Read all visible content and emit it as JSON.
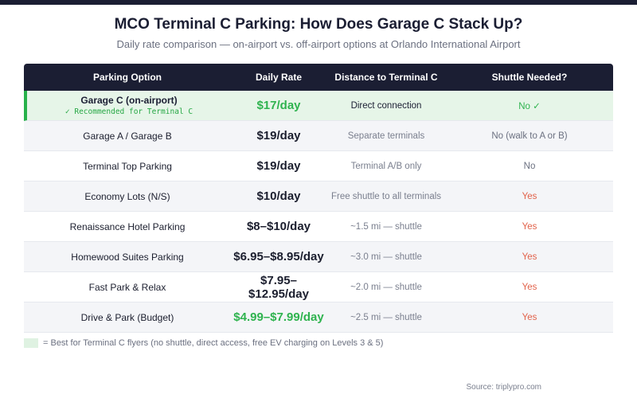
{
  "title": "MCO Terminal C Parking: How Does Garage C Stack Up?",
  "subtitle": "Daily rate comparison — on-airport vs. off-airport options at Orlando International Airport",
  "headers": [
    "Parking Option",
    "Daily Rate",
    "Distance to Terminal C",
    "Shuttle Needed?"
  ],
  "rows": [
    {
      "option": "Garage C (on-airport)",
      "note": "✓ Recommended for Terminal C",
      "rate": "$17/day",
      "distance": "Direct connection",
      "shuttle": "No ✓"
    },
    {
      "option": "Garage A / Garage B",
      "rate": "$19/day",
      "distance": "Separate terminals",
      "shuttle": "No (walk to A or B)"
    },
    {
      "option": "Terminal Top Parking",
      "rate": "$19/day",
      "distance": "Terminal A/B only",
      "shuttle": "No"
    },
    {
      "option": "Economy Lots (N/S)",
      "rate": "$10/day",
      "distance": "Free shuttle to all terminals",
      "shuttle": "Yes"
    },
    {
      "option": "Renaissance Hotel Parking",
      "rate": "$8–$10/day",
      "distance": "~1.5 mi — shuttle",
      "shuttle": "Yes"
    },
    {
      "option": "Homewood Suites Parking",
      "rate": "$6.95–$8.95/day",
      "distance": "~3.0 mi — shuttle",
      "shuttle": "Yes"
    },
    {
      "option": "Fast Park & Relax",
      "rate": "$7.95–$12.95/day",
      "distance": "~2.0 mi — shuttle",
      "shuttle": "Yes"
    },
    {
      "option": "Drive & Park (Budget)",
      "rate": "$4.99–$7.99/day",
      "distance": "~2.5 mi — shuttle",
      "shuttle": "Yes"
    }
  ],
  "legend": "= Best for Terminal C flyers (no shuttle, direct access, free EV charging on Levels 3 & 5)",
  "source": "Source: triplypro.com",
  "colors": {
    "header_bg": "#1b1e33",
    "highlight_bg": "#e6f5e8",
    "accent_green": "#2fb34f",
    "accent_red": "#e2624a"
  }
}
